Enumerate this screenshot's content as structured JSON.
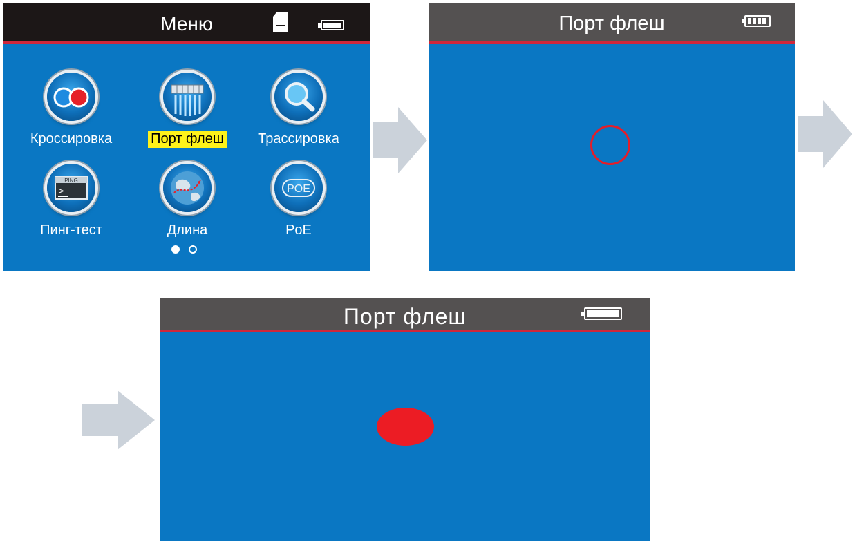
{
  "menu_screen": {
    "title": "Меню",
    "icons": [
      "sd-card-icon",
      "battery-icon"
    ],
    "apps": [
      {
        "label": "Кроссировка",
        "icon": "wiremap-icon",
        "selected": false
      },
      {
        "label": "Порт флеш",
        "icon": "port-flash-icon",
        "selected": true
      },
      {
        "label": "Трассировка",
        "icon": "magnifier-icon",
        "selected": false
      },
      {
        "label": "Пинг-тест",
        "icon": "ping-terminal-icon",
        "icon_text": "PING",
        "selected": false
      },
      {
        "label": "Длина",
        "icon": "globe-icon",
        "selected": false
      },
      {
        "label": "PoE",
        "icon": "poe-icon",
        "icon_text": "POE",
        "selected": false
      }
    ],
    "page_indicator": {
      "current": 1,
      "total": 2
    }
  },
  "port_flash_screen_1": {
    "title": "Порт флеш",
    "indicator": "red-ring-outline",
    "battery_icon": "battery-segments-icon"
  },
  "port_flash_screen_2": {
    "title": "Порт флеш",
    "indicator": "red-filled-dot",
    "battery_icon": "battery-icon"
  },
  "colors": {
    "screen_bg": "#0a77c3",
    "menu_header_bg": "#1c1717",
    "flash_header_bg": "#545151",
    "header_underline": "#d0273b",
    "selection_highlight": "#fff21a",
    "indicator_red": "#ec1c24",
    "flow_arrow": "#cbd2da"
  }
}
